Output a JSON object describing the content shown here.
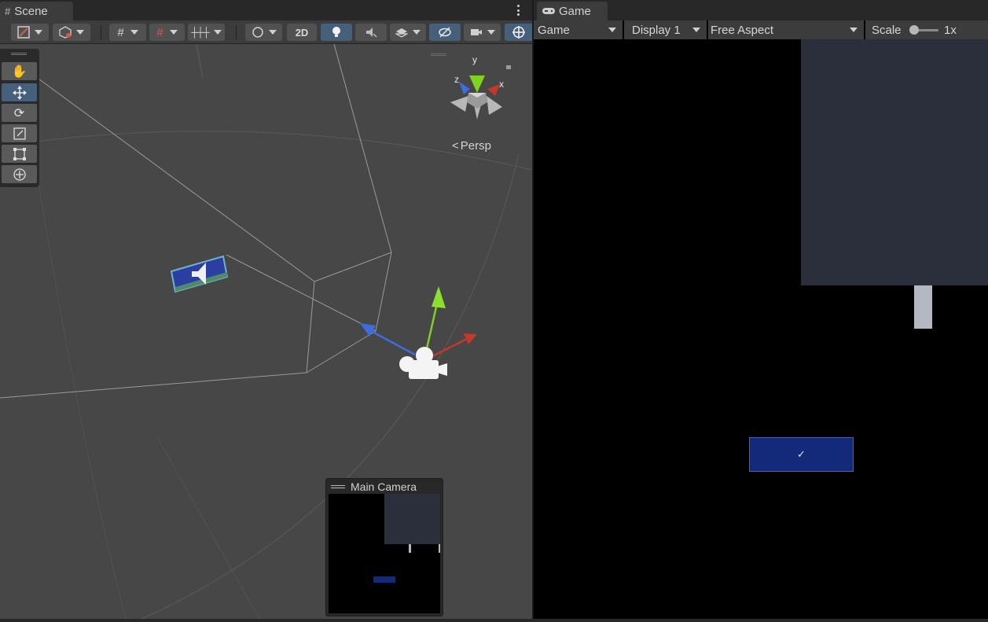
{
  "scene": {
    "tab_label": "Scene",
    "toolbar": {
      "two_d_label": "2D"
    },
    "gizmo": {
      "x_label": "x",
      "y_label": "y",
      "z_label": "z",
      "projection_label": "Persp"
    },
    "camera_preview": {
      "title": "Main Camera"
    }
  },
  "game": {
    "tab_label": "Game",
    "mode_select": "Game",
    "display_select": "Display 1",
    "aspect_select": "Free Aspect",
    "scale_label": "Scale",
    "scale_value": "1x",
    "scale_fraction": 0.0,
    "button_glyph": "✓"
  },
  "colors": {
    "panel_bg": "#474747",
    "game_bg": "#000000",
    "selection_blue": "#46607c",
    "ui_panel": "#2a2f3b",
    "ui_button": "#13297a"
  },
  "icons": [
    "grid-icon",
    "game-controller-icon",
    "more-menu-icon",
    "hand-icon",
    "move-icon",
    "rotate-icon",
    "scale-icon",
    "rect-icon",
    "transform-icon",
    "lightbulb-icon",
    "audio-mute-icon",
    "effects-icon",
    "visibility-icon",
    "camera-icon",
    "gizmo-icon",
    "speaker-icon"
  ]
}
